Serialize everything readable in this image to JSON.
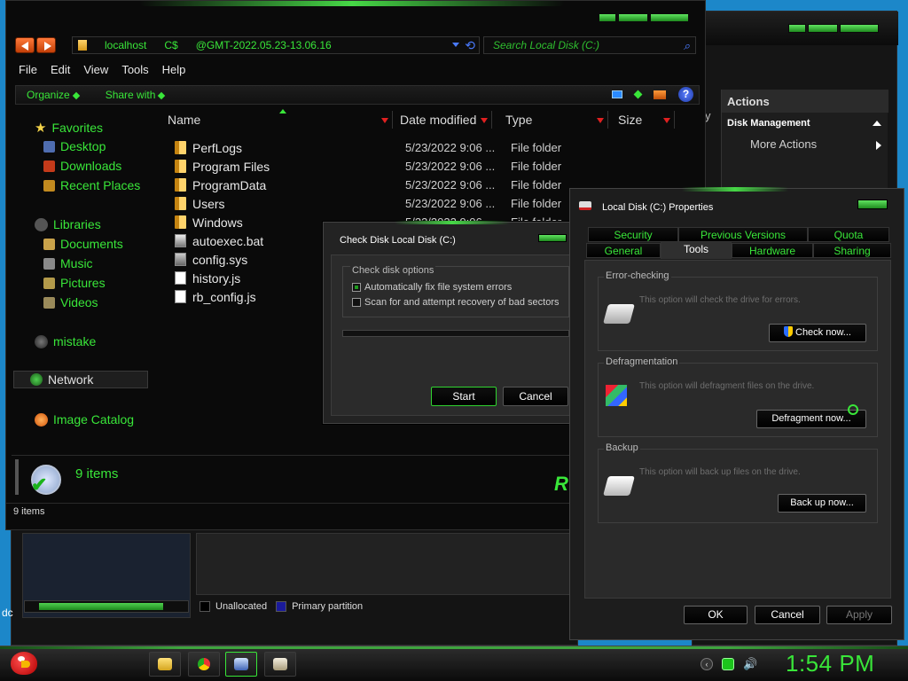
{
  "colors": {
    "accent": "#39e639",
    "desktop": "#1c87c9",
    "window_bg": "#0a0a0a",
    "sort_arrow": "#e02020"
  },
  "management": {
    "actions_header": "Actions",
    "disk_management": "Disk Management",
    "more_actions": "More Actions",
    "stub_text": "y",
    "legend": {
      "unallocated": "Unallocated",
      "primary": "Primary partition"
    },
    "desktop_stub": "dc"
  },
  "explorer": {
    "address": {
      "crumbs": [
        "localhost",
        "C$",
        "@GMT-2022.05.23-13.06.16"
      ]
    },
    "search_placeholder": "Search Local Disk (C:)",
    "menu": [
      "File",
      "Edit",
      "View",
      "Tools",
      "Help"
    ],
    "commands": {
      "organize": "Organize",
      "share_with": "Share with"
    },
    "nav": {
      "favorites": "Favorites",
      "desktop": "Desktop",
      "downloads": "Downloads",
      "recent_places": "Recent Places",
      "libraries": "Libraries",
      "documents": "Documents",
      "music": "Music",
      "pictures": "Pictures",
      "videos": "Videos",
      "mistake": "mistake",
      "network": "Network",
      "image_catalog": "Image Catalog"
    },
    "columns": {
      "name": "Name",
      "date_modified": "Date modified",
      "type": "Type",
      "size": "Size"
    },
    "files": [
      {
        "name": "PerfLogs",
        "date": "5/23/2022 9:06 ...",
        "type": "File folder",
        "kind": "folder"
      },
      {
        "name": "Program Files",
        "date": "5/23/2022 9:06 ...",
        "type": "File folder",
        "kind": "folder"
      },
      {
        "name": "ProgramData",
        "date": "5/23/2022 9:06 ...",
        "type": "File folder",
        "kind": "folder"
      },
      {
        "name": "Users",
        "date": "5/23/2022 9:06 ...",
        "type": "File folder",
        "kind": "folder"
      },
      {
        "name": "Windows",
        "date": "5/23/2022 9:06 ...",
        "type": "File folder",
        "kind": "folder"
      },
      {
        "name": "autoexec.bat",
        "date": "",
        "type": "",
        "kind": "file"
      },
      {
        "name": "config.sys",
        "date": "",
        "type": "",
        "kind": "file"
      },
      {
        "name": "history.js",
        "date": "",
        "type": "",
        "kind": "file"
      },
      {
        "name": "rb_config.js",
        "date": "",
        "type": "",
        "kind": "file"
      }
    ],
    "details_count": "9 items",
    "status": "9 items"
  },
  "chkdsk": {
    "title": "Check Disk Local Disk (C:)",
    "group_label": "Check disk options",
    "option1": "Automatically fix file system errors",
    "option1_checked": true,
    "option2": "Scan for and attempt recovery of bad sectors",
    "option2_checked": false,
    "start": "Start",
    "cancel": "Cancel"
  },
  "props": {
    "title": "Local Disk (C:) Properties",
    "tabs_row1": [
      "Security",
      "Previous Versions",
      "Quota"
    ],
    "tabs_row2": [
      "General",
      "Tools",
      "Hardware",
      "Sharing"
    ],
    "active_tab": "Tools",
    "error_checking": {
      "label": "Error-checking",
      "text": "This option will check the drive for errors.",
      "button": "Check now..."
    },
    "defrag": {
      "label": "Defragmentation",
      "text": "This option will defragment files on the drive.",
      "button": "Defragment now..."
    },
    "backup": {
      "label": "Backup",
      "text": "This option will back up files on the drive.",
      "button": "Back up now..."
    },
    "ok": "OK",
    "cancel": "Cancel",
    "apply": "Apply"
  },
  "taskbar": {
    "clock": "1:54 PM"
  }
}
